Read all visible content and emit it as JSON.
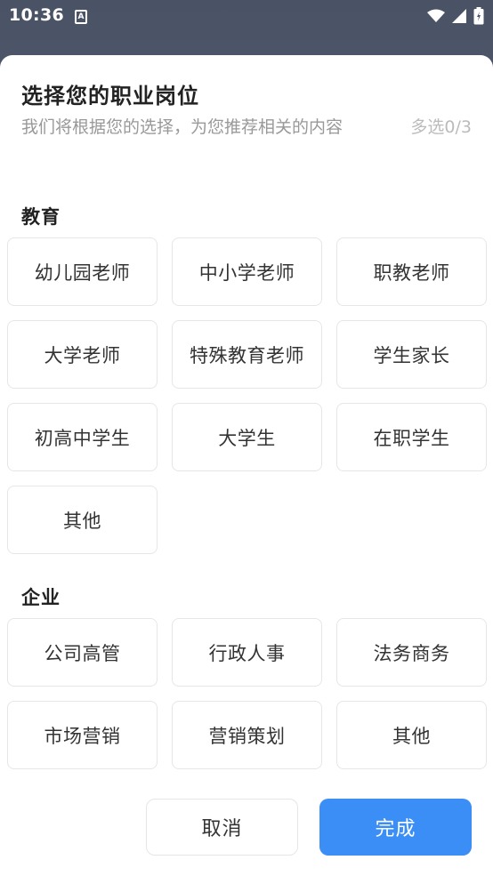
{
  "status_bar": {
    "time": "10:36",
    "a_icon": "A"
  },
  "dialog": {
    "title": "选择您的职业岗位",
    "subtitle": "我们将根据您的选择，为您推荐相关的内容",
    "counter": "多选0/3"
  },
  "sections": [
    {
      "title": "教育",
      "options": [
        "幼儿园老师",
        "中小学老师",
        "职教老师",
        "大学老师",
        "特殊教育老师",
        "学生家长",
        "初高中学生",
        "大学生",
        "在职学生",
        "其他"
      ]
    },
    {
      "title": "企业",
      "options": [
        "公司高管",
        "行政人事",
        "法务商务",
        "市场营销",
        "营销策划",
        "其他"
      ]
    }
  ],
  "buttons": {
    "cancel": "取消",
    "done": "完成"
  },
  "colors": {
    "primary": "#3a8ef6"
  }
}
